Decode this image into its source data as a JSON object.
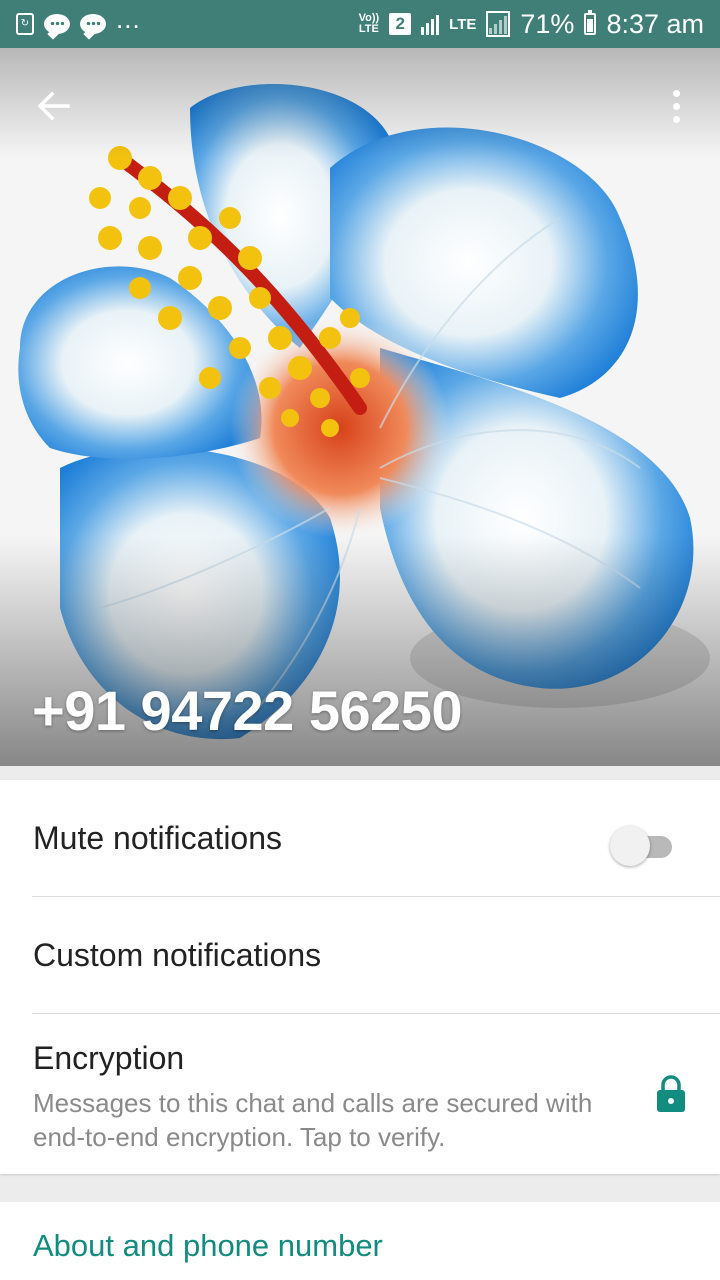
{
  "status_bar": {
    "more": "...",
    "volte_top": "Vo))",
    "volte_bottom": "LTE",
    "sim": "2",
    "lte": "LTE",
    "battery": "71%",
    "time": "8:37 am"
  },
  "header": {
    "title": "+91 94722 56250"
  },
  "settings": {
    "mute_label": "Mute notifications",
    "mute_on": false,
    "custom_label": "Custom notifications",
    "encryption_label": "Encryption",
    "encryption_desc": "Messages to this chat and calls are secured with end-to-end encryption. Tap to verify."
  },
  "about": {
    "title": "About and phone number"
  },
  "colors": {
    "status_bar": "#3f7f78",
    "accent": "#128c7e",
    "flower_blue": "#2f8fe0"
  },
  "icons": [
    "back-arrow-icon",
    "more-vert-icon",
    "lock-icon",
    "chat-bubble-icon",
    "sd-card-icon",
    "battery-icon",
    "signal-icon"
  ]
}
